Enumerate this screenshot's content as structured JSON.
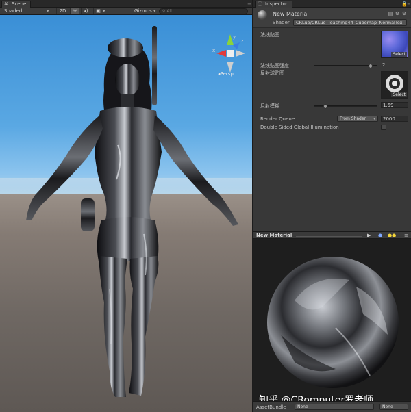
{
  "scene": {
    "tab_label": "Scene",
    "toolbar": {
      "shading_mode": "Shaded",
      "mode_2d": "2D",
      "gizmos": "Gizmos",
      "search_placeholder": "All"
    },
    "persp_label": "Persp",
    "gizmo_axes": {
      "x": "x",
      "y": "y",
      "z": "z"
    },
    "colors": {
      "sky": "#5aa8e3",
      "ground": "#7b716b"
    }
  },
  "inspector": {
    "tab_label": "Inspector",
    "material_name": "New Material",
    "shader_label": "Shader",
    "shader_value": "CRLuo/CRLuo_Teaching44_Cubemap_NormalTex",
    "properties": {
      "normal_map_label": "法线贴图",
      "normal_strength_label": "法线贴图强度",
      "normal_strength_value": "2",
      "normal_strength_fraction": 0.93,
      "reflection_map_label": "反射球贴图",
      "reflection_blur_label": "反射模糊",
      "reflection_blur_value": "1.59",
      "reflection_blur_fraction": 0.16,
      "select_label": "Select",
      "render_queue_label": "Render Queue",
      "render_queue_mode": "From Shader",
      "render_queue_value": "2000",
      "double_sided_label": "Double Sided Global Illumination"
    }
  },
  "preview": {
    "title": "New Material",
    "watermark": "知乎 @CRomputer罗老师",
    "asset_bundle_label": "AssetBundle",
    "bundle_name": "None",
    "bundle_variant": "None"
  }
}
